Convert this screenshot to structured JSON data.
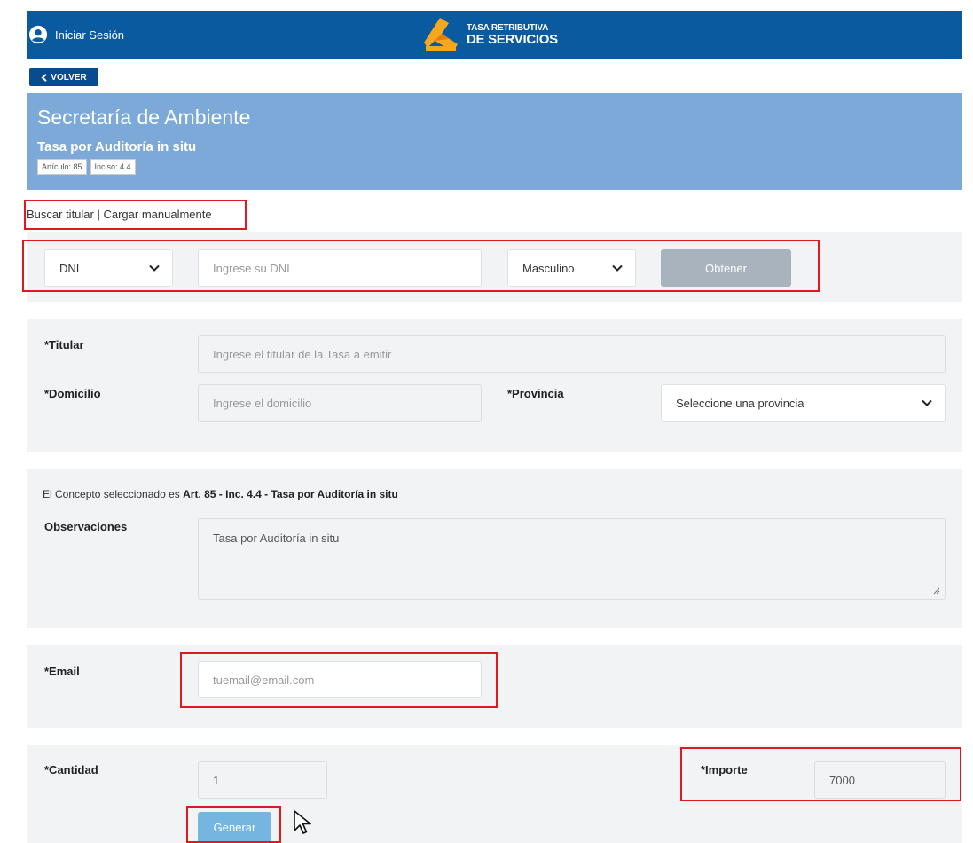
{
  "header": {
    "login_label": "Iniciar Sesión",
    "brand_line1": "TASA RETRIBUTIVA",
    "brand_line2": "DE SERVICIOS",
    "brand_color": "#0a5aa0",
    "icons": [
      "user-icon",
      "brand-logo"
    ]
  },
  "back_button": {
    "label": "VOLVER",
    "icon": "chevron-left-icon"
  },
  "hero": {
    "title": "Secretaría de Ambiente",
    "subtitle": "Tasa por Auditoría in situ",
    "tags": [
      "Artículo: 85",
      "Inciso: 4.4"
    ],
    "background": "#7da9d8"
  },
  "tabs": {
    "search": "Buscar titular",
    "separator": " | ",
    "manual": "Cargar manualmente"
  },
  "search_panel": {
    "doc_type": "DNI",
    "dni_placeholder": "Ingrese su DNI",
    "gender": "Masculino",
    "submit_label": "Obtener"
  },
  "holder_panel": {
    "titular_label": "*Titular",
    "titular_placeholder": "Ingrese el titular de la Tasa a emitir",
    "domicilio_label": "*Domicilio",
    "domicilio_placeholder": "Ingrese el domicilio",
    "provincia_label": "*Provincia",
    "provincia_placeholder": "Seleccione una provincia"
  },
  "concept_panel": {
    "intro": "El Concepto seleccionado es ",
    "concept": "Art. 85 - Inc. 4.4 - Tasa por Auditoría in situ",
    "observaciones_label": "Observaciones",
    "observaciones_value": "Tasa por Auditoría in situ"
  },
  "email_panel": {
    "label": "*Email",
    "placeholder": "tuemail@email.com"
  },
  "amount_panel": {
    "cantidad_label": "*Cantidad",
    "cantidad_value": "1",
    "importe_label": "*Importe",
    "importe_value": "7000",
    "generate_label": "Generar"
  },
  "colors": {
    "highlight": "#e0191e",
    "panel_bg": "#f1f3f5",
    "button_disabled": "#a8b3bd",
    "button_primary": "#74b6e0"
  }
}
